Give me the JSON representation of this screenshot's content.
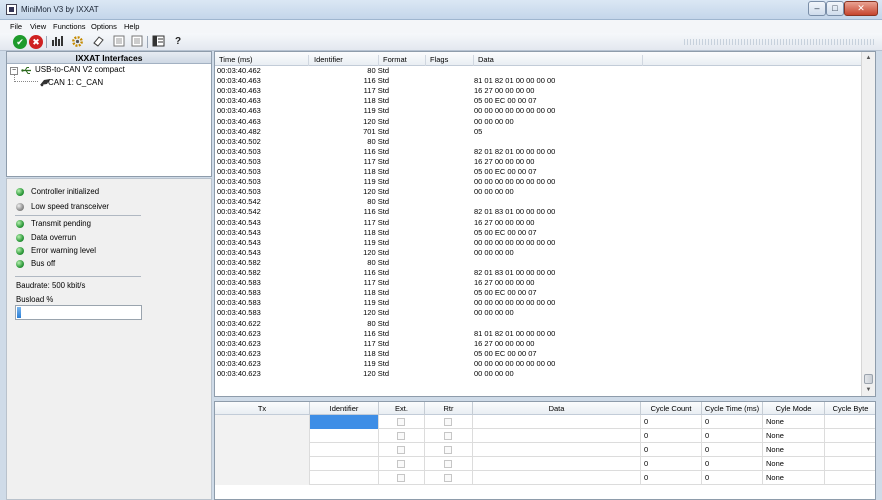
{
  "window": {
    "title": "MiniMon V3 by IXXAT",
    "min": "–",
    "max": "□",
    "close": "✕"
  },
  "menu": [
    "File",
    "View",
    "Functions",
    "Options",
    "Help"
  ],
  "toolbar": {
    "buttons": [
      "check-icon",
      "stop-icon",
      "bars-icon",
      "gear-icon",
      "eraser-icon",
      "tx-list-icon",
      "rx-list-icon",
      "window-icon",
      "help-icon"
    ],
    "check": "✔",
    "stop": "✖",
    "help": "?"
  },
  "tree": {
    "header": "IXXAT Interfaces",
    "expander": "−",
    "interface": "USB-to-CAN V2 compact",
    "channel": "CAN 1: C_CAN"
  },
  "status": {
    "items": [
      {
        "label": "Controller initialized",
        "led": "green"
      },
      {
        "label": "Low speed transceiver",
        "led": "grey"
      },
      {
        "label": "Transmit pending",
        "led": "green"
      },
      {
        "label": "Data overrun",
        "led": "green"
      },
      {
        "label": "Error warning level",
        "led": "green"
      },
      {
        "label": "Bus off",
        "led": "green"
      }
    ],
    "baudrate": "Baudrate: 500 kbit/s",
    "busload_label": "Busload %",
    "busload_fraction": 0.03
  },
  "rx": {
    "columns": [
      "Time (ms)",
      "Identifier",
      "Format",
      "Flags",
      "Data"
    ],
    "rows": [
      [
        "00:03:40.462",
        "80",
        "Std",
        ""
      ],
      [
        "00:03:40.463",
        "116",
        "Std",
        "81 01 82 01 00 00 00 00"
      ],
      [
        "00:03:40.463",
        "117",
        "Std",
        "16 27 00 00 00 00"
      ],
      [
        "00:03:40.463",
        "118",
        "Std",
        "05 00 EC 00 00 07"
      ],
      [
        "00:03:40.463",
        "119",
        "Std",
        "00 00 00 00 00 00 00 00"
      ],
      [
        "00:03:40.463",
        "120",
        "Std",
        "00 00 00 00"
      ],
      [
        "00:03:40.482",
        "701",
        "Std",
        "05"
      ],
      [
        "00:03:40.502",
        "80",
        "Std",
        ""
      ],
      [
        "00:03:40.503",
        "116",
        "Std",
        "82 01 82 01 00 00 00 00"
      ],
      [
        "00:03:40.503",
        "117",
        "Std",
        "16 27 00 00 00 00"
      ],
      [
        "00:03:40.503",
        "118",
        "Std",
        "05 00 EC 00 00 07"
      ],
      [
        "00:03:40.503",
        "119",
        "Std",
        "00 00 00 00 00 00 00 00"
      ],
      [
        "00:03:40.503",
        "120",
        "Std",
        "00 00 00 00"
      ],
      [
        "00:03:40.542",
        "80",
        "Std",
        ""
      ],
      [
        "00:03:40.542",
        "116",
        "Std",
        "82 01 83 01 00 00 00 00"
      ],
      [
        "00:03:40.543",
        "117",
        "Std",
        "16 27 00 00 00 00"
      ],
      [
        "00:03:40.543",
        "118",
        "Std",
        "05 00 EC 00 00 07"
      ],
      [
        "00:03:40.543",
        "119",
        "Std",
        "00 00 00 00 00 00 00 00"
      ],
      [
        "00:03:40.543",
        "120",
        "Std",
        "00 00 00 00"
      ],
      [
        "00:03:40.582",
        "80",
        "Std",
        ""
      ],
      [
        "00:03:40.582",
        "116",
        "Std",
        "82 01 83 01 00 00 00 00"
      ],
      [
        "00:03:40.583",
        "117",
        "Std",
        "16 27 00 00 00 00"
      ],
      [
        "00:03:40.583",
        "118",
        "Std",
        "05 00 EC 00 00 07"
      ],
      [
        "00:03:40.583",
        "119",
        "Std",
        "00 00 00 00 00 00 00 00"
      ],
      [
        "00:03:40.583",
        "120",
        "Std",
        "00 00 00 00"
      ],
      [
        "00:03:40.622",
        "80",
        "Std",
        ""
      ],
      [
        "00:03:40.623",
        "116",
        "Std",
        "81 01 82 01 00 00 00 00"
      ],
      [
        "00:03:40.623",
        "117",
        "Std",
        "16 27 00 00 00 00"
      ],
      [
        "00:03:40.623",
        "118",
        "Std",
        "05 00 EC 00 00 07"
      ],
      [
        "00:03:40.623",
        "119",
        "Std",
        "00 00 00 00 00 00 00 00"
      ],
      [
        "00:03:40.623",
        "120",
        "Std",
        "00 00 00 00"
      ]
    ]
  },
  "scroll": {
    "up": "▲",
    "down": "▼"
  },
  "tx": {
    "columns": [
      "Tx",
      "Identifier",
      "Ext.",
      "Rtr",
      "Data",
      "Cycle Count",
      "Cycle Time (ms)",
      "Cyle Mode",
      "Cycle Byte"
    ],
    "rows": [
      {
        "count": "0",
        "time": "0",
        "mode": "None"
      },
      {
        "count": "0",
        "time": "0",
        "mode": "None"
      },
      {
        "count": "0",
        "time": "0",
        "mode": "None"
      },
      {
        "count": "0",
        "time": "0",
        "mode": "None"
      },
      {
        "count": "0",
        "time": "0",
        "mode": "None"
      }
    ]
  }
}
